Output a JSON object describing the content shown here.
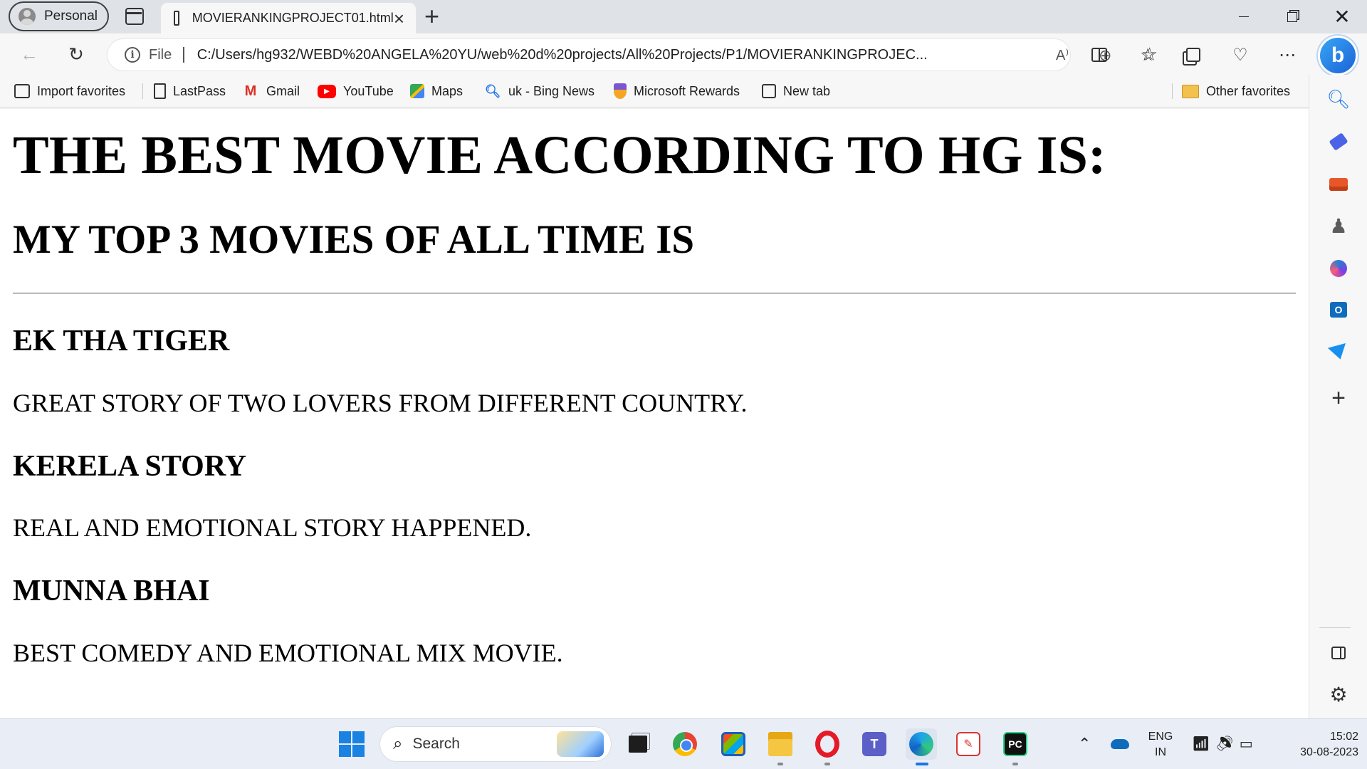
{
  "browser": {
    "profile_label": "Personal",
    "tab_title": "MOVIERANKINGPROJECT01.html",
    "tab_close": "×",
    "new_tab": "+",
    "address_scheme": "File",
    "address_url": "C:/Users/hg932/WEBD%20ANGELA%20YU/web%20d%20projects/All%20Projects/P1/MOVIERANKINGPROJEC...",
    "read_aloud": "Ȃ",
    "bing_label": "b"
  },
  "favorites_bar": {
    "items": [
      {
        "label": "Import favorites",
        "icon": "import-icon"
      },
      {
        "label": "LastPass",
        "icon": "page-icon"
      },
      {
        "label": "Gmail",
        "icon": "gmail-icon"
      },
      {
        "label": "YouTube",
        "icon": "youtube-icon"
      },
      {
        "label": "Maps",
        "icon": "maps-icon"
      },
      {
        "label": "uk - Bing News",
        "icon": "bing-search-icon"
      },
      {
        "label": "Microsoft Rewards",
        "icon": "rewards-icon"
      },
      {
        "label": "New tab",
        "icon": "new-tab-icon"
      }
    ],
    "other_favorites": "Other favorites"
  },
  "page": {
    "heading": "THE BEST MOVIE ACCORDING TO HG IS:",
    "subheading": "MY TOP 3 MOVIES OF ALL TIME IS",
    "movies": [
      {
        "title": "EK THA TIGER",
        "description": "GREAT STORY OF TWO LOVERS FROM DIFFERENT COUNTRY."
      },
      {
        "title": "KERELA STORY",
        "description": "REAL AND EMOTIONAL STORY HAPPENED."
      },
      {
        "title": "MUNNA BHAI",
        "description": "BEST COMEDY AND EMOTIONAL MIX MOVIE."
      }
    ]
  },
  "taskbar": {
    "search_placeholder": "Search",
    "language_line1": "ENG",
    "language_line2": "IN",
    "time": "15:02",
    "date": "30-08-2023"
  }
}
